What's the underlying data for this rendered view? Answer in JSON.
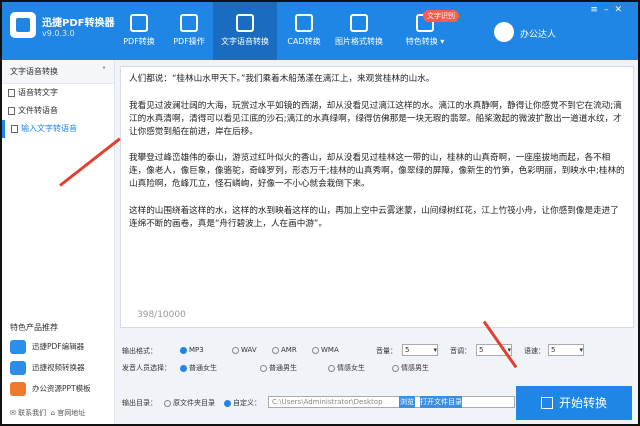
{
  "app": {
    "name": "迅捷PDF转换器",
    "version": "v9.0.3.0"
  },
  "tabs": [
    "PDF转换",
    "PDF操作",
    "文字语音转换",
    "CAD转换",
    "图片格式转换",
    "特色转换"
  ],
  "badge": "文字识别",
  "user": "办公达人",
  "sidebar": {
    "section": "文字语音转换",
    "items": [
      "语音转文字",
      "文件转语音",
      "输入文字转语音"
    ],
    "products_title": "特色产品推荐",
    "products": [
      "迅捷PDF编辑器",
      "迅捷视频转换器",
      "办公资源PPT模板"
    ],
    "footer_contact": "联系我们",
    "footer_site": "官网地址"
  },
  "text": {
    "p1": "人们都说：“桂林山水甲天下。”我们乘着木船荡漾在漓江上，来观赏桂林的山水。",
    "p2": "我看见过波澜壮阔的大海，玩赏过水平如镜的西湖，却从没看见过漓江这样的水。漓江的水真静啊，静得让你感觉不到它在流动;漓江的水真清啊，清得可以看见江底的沙石;漓江的水真绿啊，绿得仿佛那是一块无瑕的翡翠。船桨激起的微波扩散出一道道水纹，才让你感觉到船在前进，岸在后移。",
    "p3": "我攀登过峰峦雄伟的泰山，游览过红叶似火的香山，却从没看见过桂林这一带的山，桂林的山真奇啊，一座座拔地而起，各不相连，像老人，像巨象，像骆驼，奇峰罗列，形态万千;桂林的山真秀啊，像翠绿的屏障，像新生的竹笋，色彩明丽，到映水中;桂林的山真险啊，危峰兀立，怪石嶙峋，好像一不小心就会栽倒下来。",
    "p4": "这样的山围绕着这样的水，这样的水到映着这样的山，再加上空中云雾迷蒙，山间绿树红花，江上竹筏小舟，让你感到像是走进了连绵不断的画卷，真是“舟行碧波上，人在画中游”。",
    "count": "398/10000"
  },
  "options": {
    "format_label": "输出格式：",
    "formats": [
      "MP3",
      "WAV",
      "AMR",
      "WMA"
    ],
    "selected_format": "MP3",
    "volume_label": "音量：",
    "volume": "5",
    "pitch_label": "音调：",
    "pitch": "5",
    "speed_label": "语速：",
    "speed": "5",
    "voice_label": "发音人员选择：",
    "voices": [
      "普通女生",
      "普通男生",
      "情感女生",
      "情感男生"
    ],
    "selected_voice": "普通女生"
  },
  "output": {
    "label": "输出目录：",
    "opt_source": "原文件夹目录",
    "opt_custom": "自定义：",
    "path": "C:\\Users\\Administrator\\Desktop",
    "browse": "浏览",
    "open": "打开文件目录"
  },
  "start_label": "开始转换",
  "colors": {
    "accent": "#1f86e5",
    "arrow": "#e53d2f"
  }
}
